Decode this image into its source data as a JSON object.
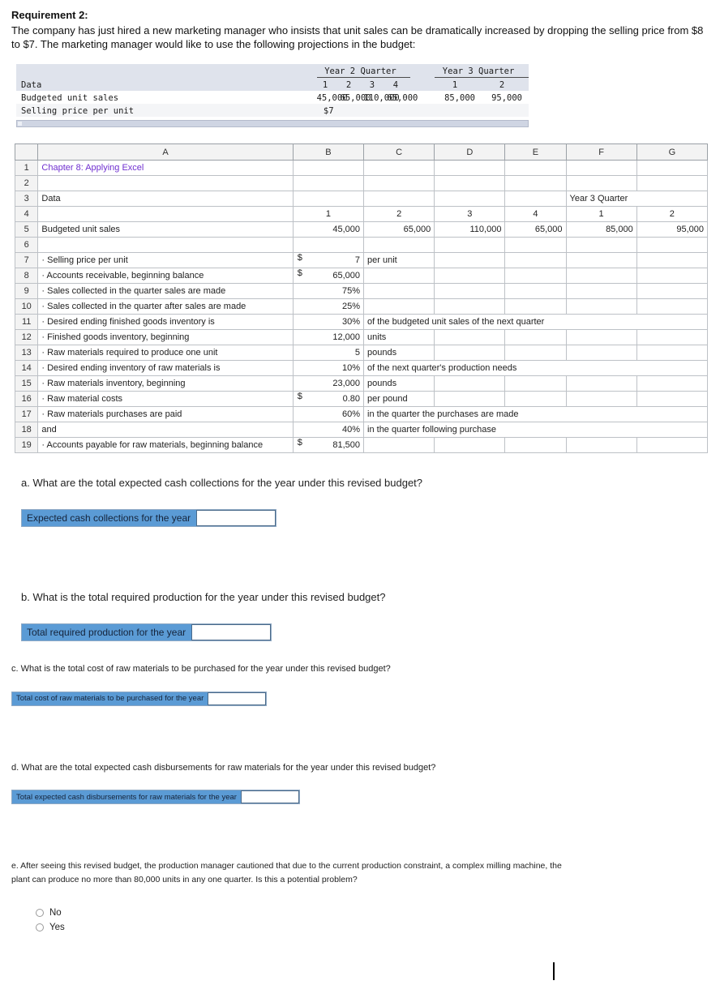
{
  "intro": {
    "title": "Requirement 2:",
    "body": "The company has just hired a new marketing manager who insists that unit sales can be dramatically increased by dropping the selling price from $8 to $7. The marketing manager would like to use the following projections in the budget:"
  },
  "data_table": {
    "year2_header": "Year 2 Quarter",
    "year3_header": "Year 3 Quarter",
    "row_label_header": "Data",
    "quarter_labels": [
      "1",
      "2",
      "3",
      "4",
      "1",
      "2"
    ],
    "rows": [
      {
        "label": "Budgeted unit sales",
        "values": [
          "45,000",
          "65,000",
          "110,000",
          "65,000",
          "85,000",
          "95,000"
        ]
      },
      {
        "label": "Selling price per unit",
        "values": [
          "$7",
          "",
          "",
          "",
          "",
          ""
        ]
      }
    ]
  },
  "spreadsheet": {
    "columns": [
      "A",
      "B",
      "C",
      "D",
      "E",
      "F",
      "G"
    ],
    "row_numbers": [
      "1",
      "2",
      "3",
      "4",
      "5",
      "6",
      "7",
      "8",
      "9",
      "10",
      "11",
      "12",
      "13",
      "14",
      "15",
      "16",
      "17",
      "18",
      "19"
    ],
    "r1_a": "Chapter 8: Applying Excel",
    "r3_a": "Data",
    "r3_f": "Year 3 Quarter",
    "r4": {
      "b": "1",
      "c": "2",
      "d": "3",
      "e": "4",
      "f": "1",
      "g": "2"
    },
    "r5": {
      "a": "Budgeted unit sales",
      "b": "45,000",
      "c": "65,000",
      "d": "110,000",
      "e": "65,000",
      "f": "85,000",
      "g": "95,000"
    },
    "r7": {
      "a": "· Selling price per unit",
      "sym": "$",
      "b": "7",
      "c": "per unit"
    },
    "r8": {
      "a": "· Accounts receivable, beginning balance",
      "sym": "$",
      "b": "65,000",
      "c": ""
    },
    "r9": {
      "a": "· Sales collected in the quarter sales are made",
      "b": "75%",
      "c": ""
    },
    "r10": {
      "a": "· Sales collected in the quarter after sales are made",
      "b": "25%",
      "c": ""
    },
    "r11": {
      "a": "· Desired ending finished goods inventory is",
      "b": "30%",
      "c": "of the budgeted unit sales of the next quarter"
    },
    "r12": {
      "a": "· Finished goods inventory, beginning",
      "b": "12,000",
      "c": "units"
    },
    "r13": {
      "a": "· Raw materials required to produce one unit",
      "b": "5",
      "c": "pounds"
    },
    "r14": {
      "a": "· Desired ending inventory of raw materials is",
      "b": "10%",
      "c": "of the next quarter's production needs"
    },
    "r15": {
      "a": "· Raw materials inventory, beginning",
      "b": "23,000",
      "c": "pounds"
    },
    "r16": {
      "a": "· Raw material costs",
      "sym": "$",
      "b": "0.80",
      "c": "per pound"
    },
    "r17": {
      "a": "· Raw materials purchases are paid",
      "b": "60%",
      "c": "in the quarter the purchases are made"
    },
    "r18": {
      "a": "and",
      "b": "40%",
      "c": "in the quarter following purchase"
    },
    "r19": {
      "a": "· Accounts payable for raw materials, beginning balance",
      "sym": "$",
      "b": "81,500",
      "c": ""
    }
  },
  "questions": {
    "a": {
      "text": "a. What are the total expected cash collections for the year under this revised budget?",
      "answer_label": "Expected cash collections for the year",
      "answer_value": ""
    },
    "b": {
      "text": "b. What is the total required production for the year under this revised budget?",
      "answer_label": "Total required production for the year",
      "answer_value": ""
    },
    "c": {
      "text": "c. What is the total cost of raw materials to be purchased for the year under this revised budget?",
      "answer_label": "Total cost of raw materials to be purchased for the year",
      "answer_value": ""
    },
    "d": {
      "text": "d. What are the total expected cash disbursements for raw materials for the year under this revised budget?",
      "answer_label": "Total expected cash disbursements for raw materials for the year",
      "answer_value": ""
    },
    "e": {
      "text": "e. After seeing this revised budget, the production manager cautioned that due to the current production constraint, a complex milling machine, the plant can produce no more than 80,000 units in any one quarter. Is this a potential problem?",
      "options": [
        {
          "label": "No",
          "selected": false
        },
        {
          "label": "Yes",
          "selected": false
        }
      ]
    }
  },
  "colors": {
    "accent_purple": "#7030d0",
    "answer_blue": "#5b9bd5",
    "header_band": "#dfe3ec"
  }
}
